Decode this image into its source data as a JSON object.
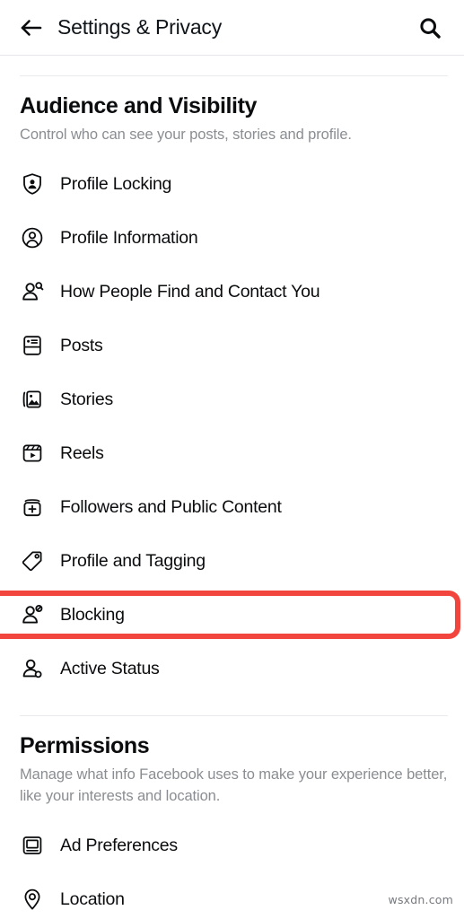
{
  "header": {
    "title": "Settings & Privacy",
    "back_icon": "arrow-left-icon",
    "search_icon": "search-icon"
  },
  "sections": [
    {
      "id": "audience-and-visibility",
      "title": "Audience and Visibility",
      "subtitle": "Control who can see your posts, stories and profile.",
      "items": [
        {
          "label": "Profile Locking",
          "icon": "shield-person-icon",
          "highlighted": false
        },
        {
          "label": "Profile Information",
          "icon": "person-circle-icon",
          "highlighted": false
        },
        {
          "label": "How People Find and Contact You",
          "icon": "person-search-icon",
          "highlighted": false
        },
        {
          "label": "Posts",
          "icon": "post-card-icon",
          "highlighted": false
        },
        {
          "label": "Stories",
          "icon": "photo-stack-icon",
          "highlighted": false
        },
        {
          "label": "Reels",
          "icon": "reels-play-icon",
          "highlighted": false
        },
        {
          "label": "Followers and Public Content",
          "icon": "followers-plus-icon",
          "highlighted": false
        },
        {
          "label": "Profile and Tagging",
          "icon": "tag-icon",
          "highlighted": false
        },
        {
          "label": "Blocking",
          "icon": "person-block-icon",
          "highlighted": true
        },
        {
          "label": "Active Status",
          "icon": "person-status-icon",
          "highlighted": false
        }
      ]
    },
    {
      "id": "permissions",
      "title": "Permissions",
      "subtitle": "Manage what info Facebook uses to make your experience better, like your interests and location.",
      "items": [
        {
          "label": "Ad Preferences",
          "icon": "monitor-icon",
          "highlighted": false
        },
        {
          "label": "Location",
          "icon": "location-pin-icon",
          "highlighted": false
        }
      ]
    }
  ],
  "highlight_color": "#F2453D",
  "watermark": "wsxdn.com"
}
